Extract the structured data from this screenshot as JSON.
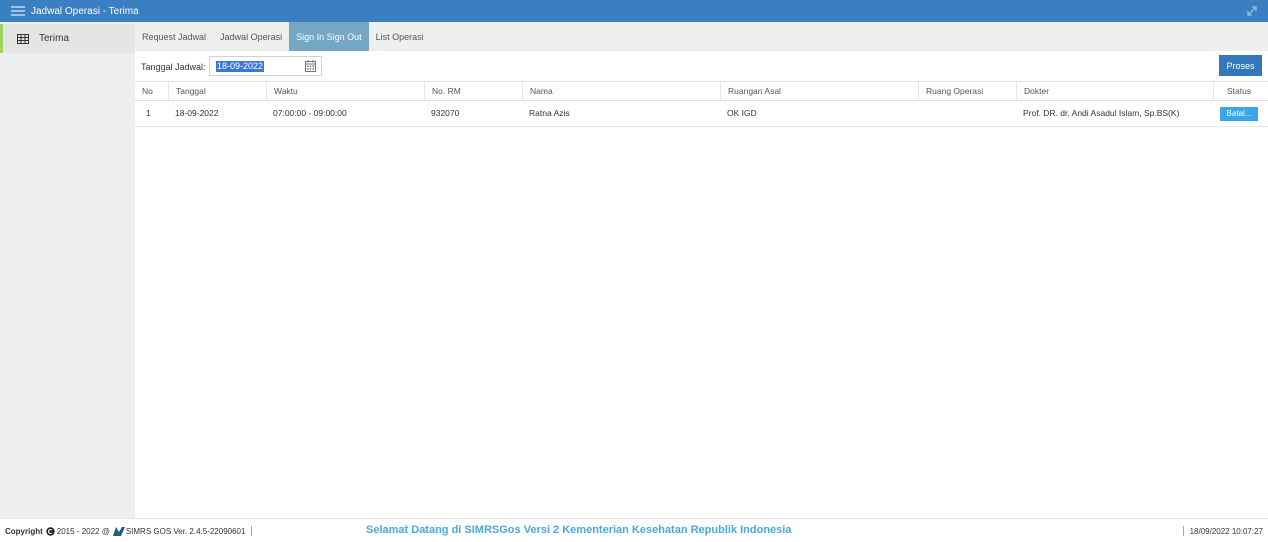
{
  "window": {
    "title": "Jadwal Operasi - Terima"
  },
  "sidebar": {
    "items": [
      {
        "label": "Terima",
        "icon": "table-icon"
      }
    ]
  },
  "tabs": [
    {
      "label": "Request Jadwal",
      "active": false
    },
    {
      "label": "Jadwal Operasi",
      "active": false
    },
    {
      "label": "Sign In Sign Out",
      "active": true
    },
    {
      "label": "List Operasi",
      "active": false
    }
  ],
  "filter": {
    "label": "Tanggal Jadwal:",
    "value": "18-09-2022"
  },
  "toolbar": {
    "proses_label": "Proses"
  },
  "table": {
    "columns": [
      "No",
      "Tanggal",
      "Waktu",
      "No. RM",
      "Nama",
      "Ruangan Asal",
      "Ruang Operasi",
      "Dokter",
      "Status"
    ],
    "rows": [
      {
        "no": "1",
        "tanggal": "18-09-2022",
        "waktu": "07:00:00 - 09:00:00",
        "no_rm": "932070",
        "nama": "Ratna Azis",
        "ruangan_asal": "OK IGD",
        "ruang_operasi": "",
        "dokter": "Prof. DR. dr. Andi Asadul Islam, Sp.BS(K)",
        "status_button": "Batal..."
      }
    ]
  },
  "footer": {
    "copyright_label": "Copyright",
    "copyright_years": "2015 - 2022 @",
    "app_version": "SIMRS GOS Ver. 2.4.5-22090601",
    "welcome": "Selamat Datang di SIMRSGos Versi 2 Kementerian Kesehatan Republik Indonesia",
    "datetime": "18/09/2022 10:07:27"
  },
  "colors": {
    "titlebar": "#3a7fc1",
    "active_tab": "#73a7c3",
    "primary_button": "#3578ba",
    "status_button": "#3aa5ea",
    "welcome_text": "#49a8de",
    "sidebar_accent": "#9fd060"
  }
}
